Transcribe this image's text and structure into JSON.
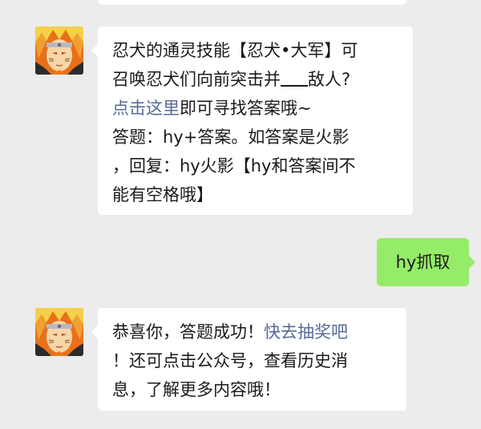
{
  "messages": [
    {
      "sender": "official-account",
      "avatar_icon": "naruto-avatar-icon",
      "lines": [
        [
          "忍犬的通灵技能【忍犬•大军】可"
        ],
        [
          "召唤忍犬们向前突击并",
          "敌人?"
        ],
        [
          "点击这里",
          "即可寻找答案哦~"
        ],
        [
          "答题：hy+答案。如答案是火影"
        ],
        [
          "，回复：hy火影【hy和答案间不"
        ],
        [
          "能有空格哦】"
        ]
      ]
    },
    {
      "sender": "me",
      "text": "hy抓取"
    },
    {
      "sender": "official-account",
      "avatar_icon": "naruto-avatar-icon",
      "lines": [
        [
          "恭喜你，答题成功！",
          "快去抽奖吧"
        ],
        [
          "！还可点击公众号，查看历史消"
        ],
        [
          "息，了解更多内容哦！"
        ]
      ]
    }
  ],
  "colors": {
    "background": "#ececec",
    "bubble_left": "#ffffff",
    "bubble_right": "#95ec69",
    "link": "#576b95"
  }
}
